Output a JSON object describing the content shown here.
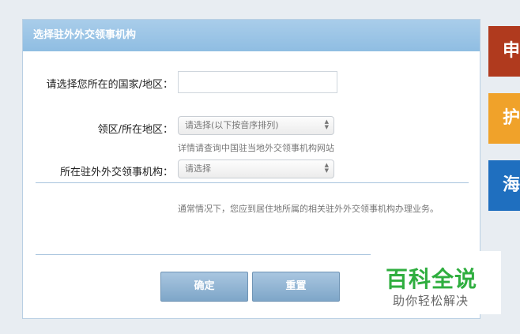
{
  "panel": {
    "title": "选择驻外外交领事机构"
  },
  "form": {
    "country_label": "请选择您所在的国家/地区：",
    "country_value": "",
    "district_label": "领区/所在地区：",
    "district_selected": "请选择(以下按音序排列)",
    "district_hint": "详情请查询中国驻当地外交领事机构网站",
    "mission_label": "所在驻外外交领事机构：",
    "mission_selected": "请选择",
    "notice": "通常情况下，您应到居住地所属的相关驻外外交领事机构办理业务。"
  },
  "buttons": {
    "confirm_label": "确定",
    "reset_label": "重置"
  },
  "side_tiles": [
    {
      "label": "申",
      "color": "#b03a1e"
    },
    {
      "label": "护",
      "color": "#f0a22a"
    },
    {
      "label": "海",
      "color": "#1f6fbf"
    }
  ],
  "watermark": {
    "title": "百科全说",
    "subtitle": "助你轻松解决"
  },
  "colors": {
    "header_bg": "#9fc7e7",
    "button_bg": "#8fb2d2",
    "watermark_green": "#2fae3f"
  }
}
